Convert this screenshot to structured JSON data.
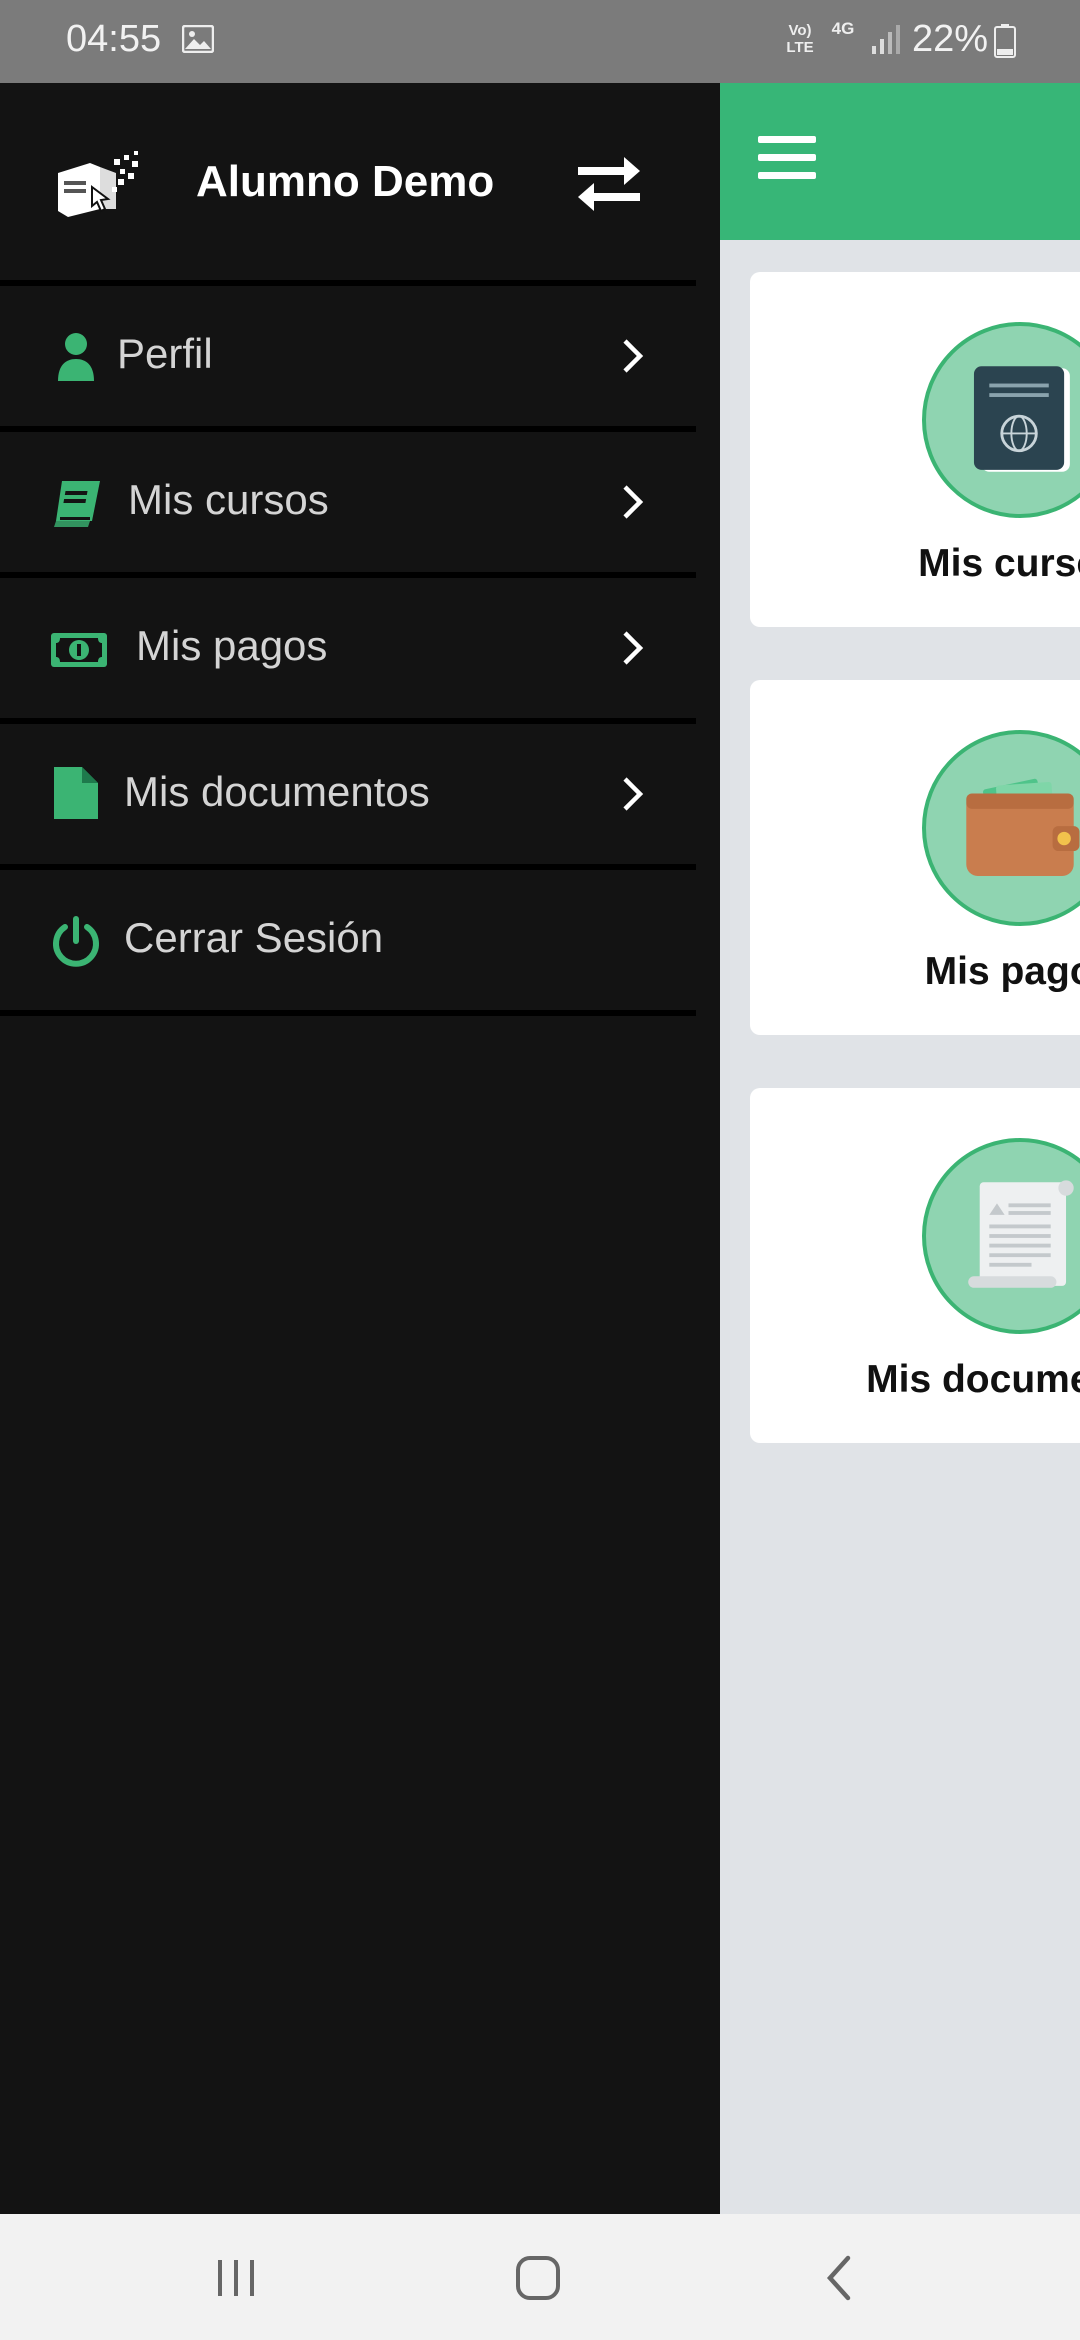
{
  "status_bar": {
    "time": "04:55",
    "volte_label": "Vo) LTE",
    "network_label": "4G",
    "battery": "22%"
  },
  "drawer": {
    "user_name": "Alumno Demo",
    "items": [
      {
        "label": "Perfil",
        "icon": "user-icon",
        "has_chevron": true
      },
      {
        "label": "Mis cursos",
        "icon": "book-icon",
        "has_chevron": true
      },
      {
        "label": "Mis pagos",
        "icon": "money-bill-icon",
        "has_chevron": true
      },
      {
        "label": "Mis documentos",
        "icon": "file-icon",
        "has_chevron": true
      },
      {
        "label": "Cerrar Sesión",
        "icon": "power-icon",
        "has_chevron": false
      }
    ]
  },
  "main": {
    "cards": [
      {
        "label": "Mis cursos",
        "icon": "passport-book-icon"
      },
      {
        "label": "Mis pagos",
        "icon": "wallet-icon"
      },
      {
        "label": "Mis documentos",
        "icon": "document-scroll-icon"
      }
    ]
  },
  "colors": {
    "accent": "#37b677",
    "drawer_bg": "#131313",
    "status_bar": "#7b7b7b",
    "content_bg": "#e0e3e7",
    "circle_fill": "#8fd4b1"
  }
}
